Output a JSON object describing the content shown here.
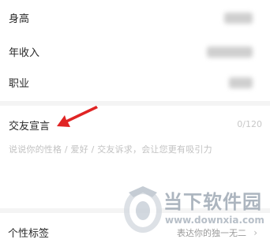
{
  "profile_fields": [
    {
      "label": "身高"
    },
    {
      "label": "年收入"
    },
    {
      "label": "职业"
    }
  ],
  "declaration": {
    "title": "交友宣言",
    "counter": "0/120",
    "placeholder": "说说你的性格 / 爱好 / 交友诉求，会让您更有吸引力"
  },
  "tags": {
    "label": "个性标签",
    "hint": "表达你的独一无二"
  },
  "watermark": {
    "name": "当下软件园",
    "url": "www.downxia.com"
  },
  "colors": {
    "annotation_arrow": "#e02424",
    "placeholder": "#c2c2c2"
  },
  "icons": {
    "tags_chevron": "chevron-right-icon",
    "annotation": "red-arrow-icon"
  }
}
